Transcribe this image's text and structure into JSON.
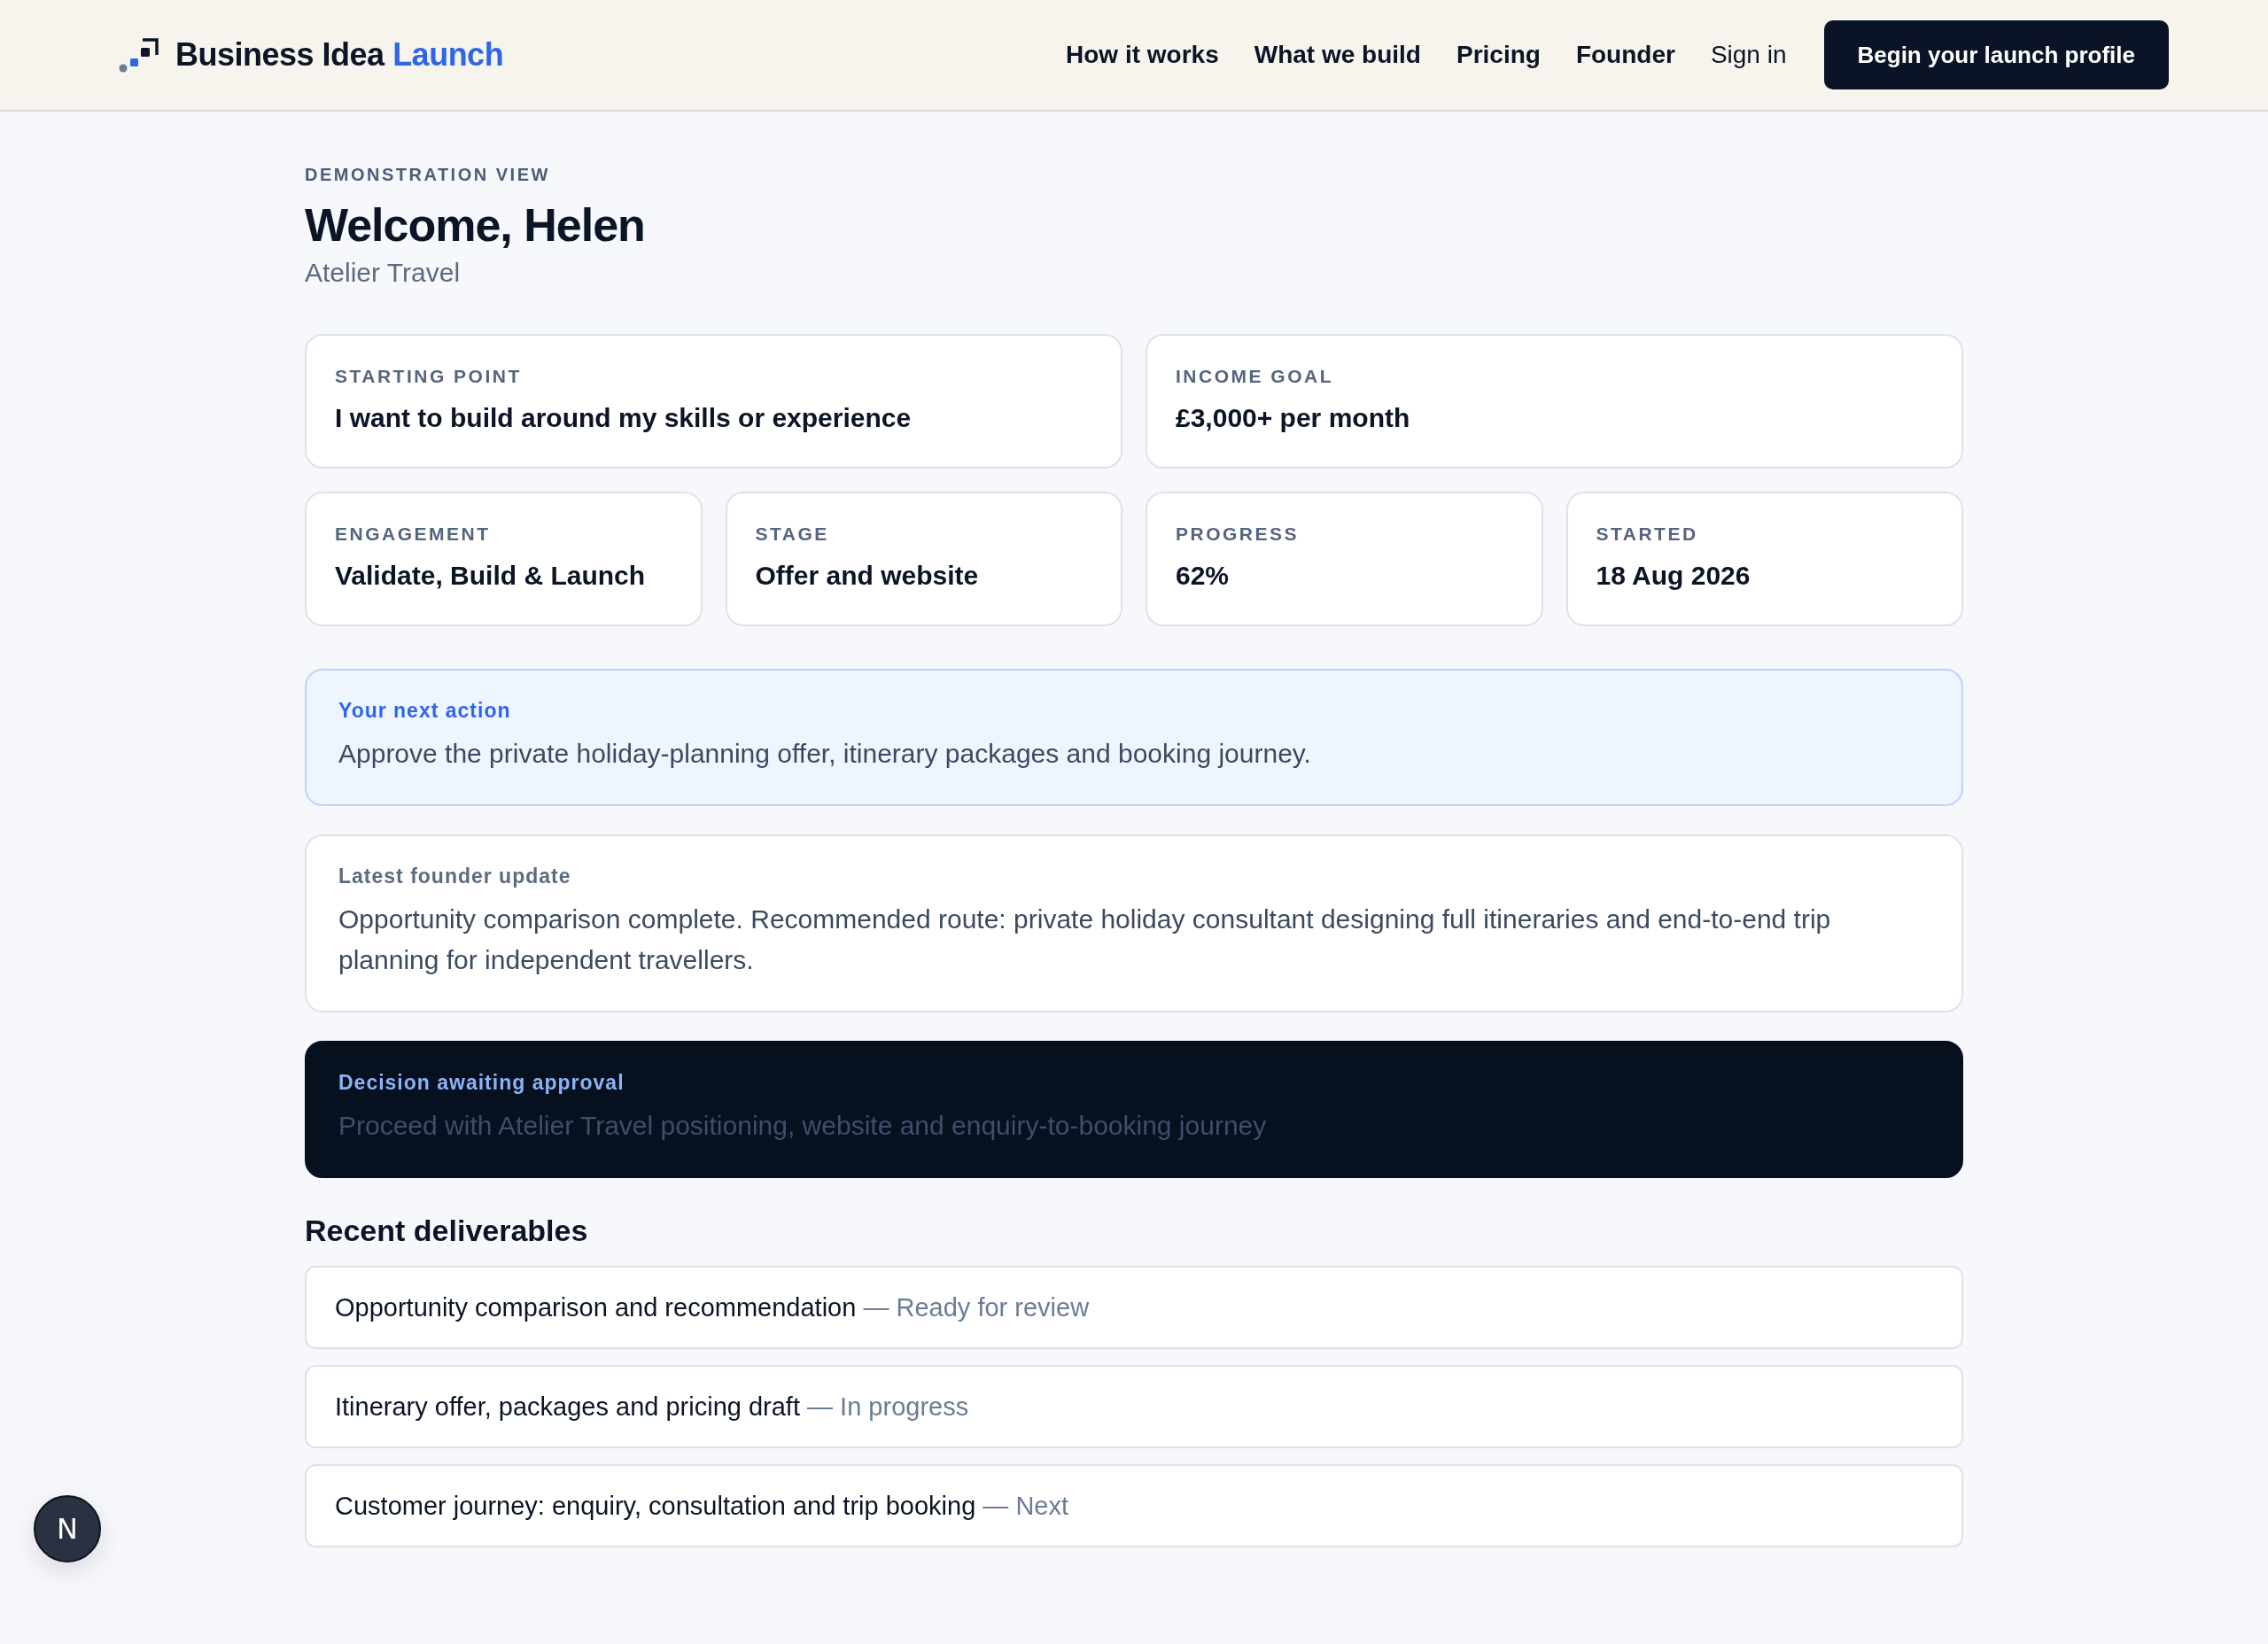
{
  "header": {
    "brand": "Business Idea",
    "brand_accent": "Launch",
    "nav": [
      "How it works",
      "What we build",
      "Pricing",
      "Founder"
    ],
    "sign_in": "Sign in",
    "cta": "Begin your launch profile"
  },
  "intro": {
    "eyebrow": "DEMONSTRATION VIEW",
    "title": "Welcome, Helen",
    "subtitle": "Atelier Travel"
  },
  "summary_rows": [
    [
      {
        "label": "STARTING POINT",
        "value": "I want to build around my skills or experience"
      },
      {
        "label": "INCOME GOAL",
        "value": "£3,000+ per month"
      }
    ],
    [
      {
        "label": "ENGAGEMENT",
        "value": "Validate, Build & Launch"
      },
      {
        "label": "STAGE",
        "value": "Offer and website"
      },
      {
        "label": "PROGRESS",
        "value": "62%"
      },
      {
        "label": "STARTED",
        "value": "18 Aug 2026"
      }
    ]
  ],
  "notices": [
    {
      "kind": "action",
      "title": "Your next action",
      "text": "Approve the private holiday-planning offer, itinerary packages and booking journey."
    },
    {
      "kind": "update",
      "title": "Latest founder update",
      "text": "Opportunity comparison complete. Recommended route: private holiday consultant designing full itineraries and end-to-end trip planning for independent travellers."
    },
    {
      "kind": "decision",
      "title": "Decision awaiting approval",
      "text": "Proceed with Atelier Travel positioning, website and enquiry-to-booking journey"
    }
  ],
  "deliverables": {
    "title": "Recent deliverables",
    "items": [
      {
        "name": "Opportunity comparison and recommendation",
        "status": "— Ready for review"
      },
      {
        "name": "Itinerary offer, packages and pricing draft",
        "status": "— In progress"
      },
      {
        "name": "Customer journey: enquiry, consultation and trip booking",
        "status": "— Next"
      }
    ]
  },
  "dev_badge": "N"
}
